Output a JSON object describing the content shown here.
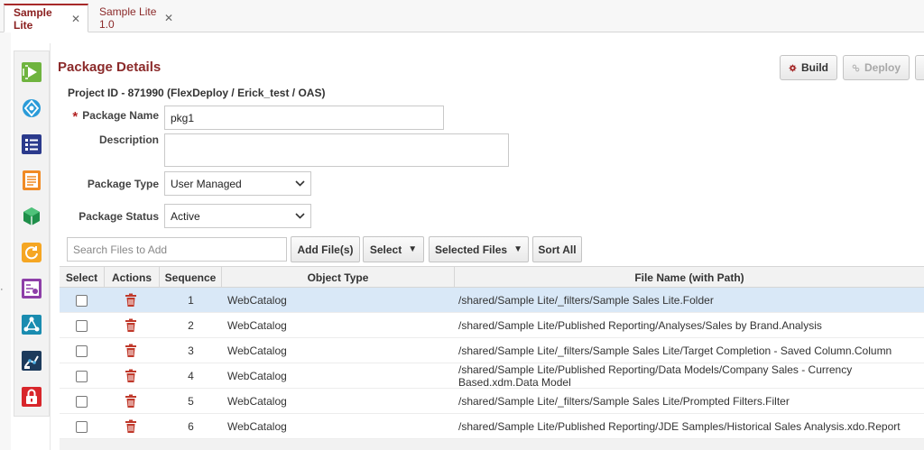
{
  "tabs": [
    {
      "label": "Sample Lite",
      "active": true
    },
    {
      "label": "Sample Lite 1.0",
      "active": false
    }
  ],
  "tab_close_glyph": "✕",
  "left_edge_mark": "·",
  "sidebar_icons": [
    "execute-icon",
    "integration-icon",
    "list-icon",
    "document-icon",
    "package-icon",
    "refresh-icon",
    "template-icon",
    "network-icon",
    "robot-icon",
    "lock-icon"
  ],
  "panel": {
    "title": "Package Details",
    "project_id": "Project ID - 871990 (FlexDeploy / Erick_test / OAS)"
  },
  "toolbar": {
    "build_label": "Build",
    "deploy_label": "Deploy"
  },
  "form": {
    "required_mark": "*",
    "package_name_label": "Package Name",
    "package_name_value": "pkg1",
    "description_label": "Description",
    "description_value": "",
    "package_type_label": "Package Type",
    "package_type_value": "User Managed",
    "package_status_label": "Package Status",
    "package_status_value": "Active"
  },
  "files_toolbar": {
    "search_placeholder": "Search Files to Add",
    "add_files_label": "Add File(s)",
    "select_label": "Select",
    "selected_files_label": "Selected Files",
    "sort_all_label": "Sort All"
  },
  "table": {
    "headers": [
      "Select",
      "Actions",
      "Sequence",
      "Object Type",
      "File Name (with Path)"
    ],
    "rows": [
      {
        "sequence": "1",
        "object_type": "WebCatalog",
        "file": "/shared/Sample Lite/_filters/Sample Sales Lite.Folder",
        "selected": true
      },
      {
        "sequence": "2",
        "object_type": "WebCatalog",
        "file": "/shared/Sample Lite/Published Reporting/Analyses/Sales by Brand.Analysis",
        "selected": false
      },
      {
        "sequence": "3",
        "object_type": "WebCatalog",
        "file": "/shared/Sample Lite/_filters/Sample Sales Lite/Target Completion - Saved Column.Column",
        "selected": false
      },
      {
        "sequence": "4",
        "object_type": "WebCatalog",
        "file": "/shared/Sample Lite/Published Reporting/Data Models/Company Sales - Currency Based.xdm.Data Model",
        "selected": false
      },
      {
        "sequence": "5",
        "object_type": "WebCatalog",
        "file": "/shared/Sample Lite/_filters/Sample Sales Lite/Prompted Filters.Filter",
        "selected": false
      },
      {
        "sequence": "6",
        "object_type": "WebCatalog",
        "file": "/shared/Sample Lite/Published Reporting/JDE Samples/Historical Sales Analysis.xdo.Report",
        "selected": false
      }
    ]
  },
  "colors": {
    "accent": "#8b2a2a",
    "selected_row": "#d9e8f7"
  }
}
